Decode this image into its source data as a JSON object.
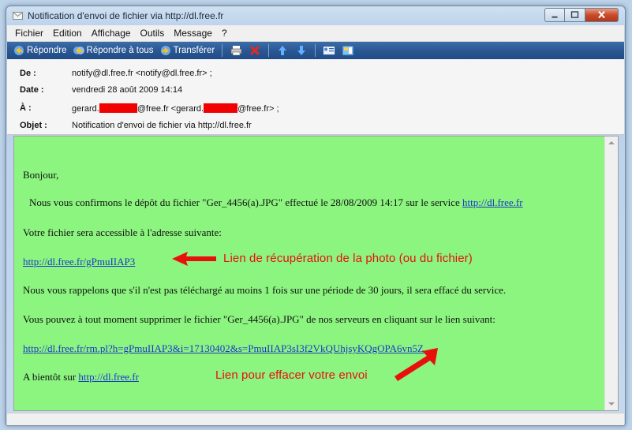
{
  "window": {
    "title": "Notification d'envoi de fichier via http://dl.free.fr"
  },
  "menu": [
    "Fichier",
    "Edition",
    "Affichage",
    "Outils",
    "Message",
    "?"
  ],
  "toolbar": {
    "reply_label": "Répondre",
    "reply_all_label": "Répondre à tous",
    "forward_label": "Transférer"
  },
  "headers": {
    "from_label": "De :",
    "from_value": "notify@dl.free.fr <notify@dl.free.fr> ;",
    "date_label": "Date :",
    "date_value": "vendredi 28 août 2009 14:14",
    "to_label": "À :",
    "to_part1": "gerard.",
    "to_part2": "@free.fr <gerard.",
    "to_part3": "@free.fr> ;",
    "subject_label": "Objet :",
    "subject_value": "Notification d'envoi de fichier via http://dl.free.fr"
  },
  "message": {
    "greeting": "Bonjour,",
    "confirm_text": "Nous vous confirmons le dépôt du fichier \"Ger_4456(a).JPG\" effectué le 28/08/2009 14:17 sur le service",
    "service_link": "http://dl.free.fr",
    "access_text": "Votre fichier sera accessible à l'adresse suivante:",
    "download_link": "http://dl.free.fr/gPmuIIAP3",
    "reminder_text": "Nous vous rappelons que s'il n'est pas téléchargé au moins 1 fois sur une période de 30 jours, il sera effacé du service.",
    "delete_text": "Vous pouvez à tout moment supprimer le fichier \"Ger_4456(a).JPG\" de nos serveurs en cliquant sur le lien suivant:",
    "delete_link": "http://dl.free.fr/rm.pl?h=gPmuIIAP3&i=17130402&s=PmuIIAP3sI3f2VkQUhjsyKQgOPA6vn5Z",
    "bye_text": "A bientôt sur",
    "bye_link": "http://dl.free.fr"
  },
  "annotations": {
    "download_note": "Lien de récupération de la photo (ou du fichier)",
    "delete_note": "Lien pour effacer votre envoi"
  },
  "colors": {
    "body_background": "#8cf57f",
    "annotation_red": "#e8100c",
    "link_blue": "#1a37c9",
    "toolbar_blue": "#2b5793"
  }
}
